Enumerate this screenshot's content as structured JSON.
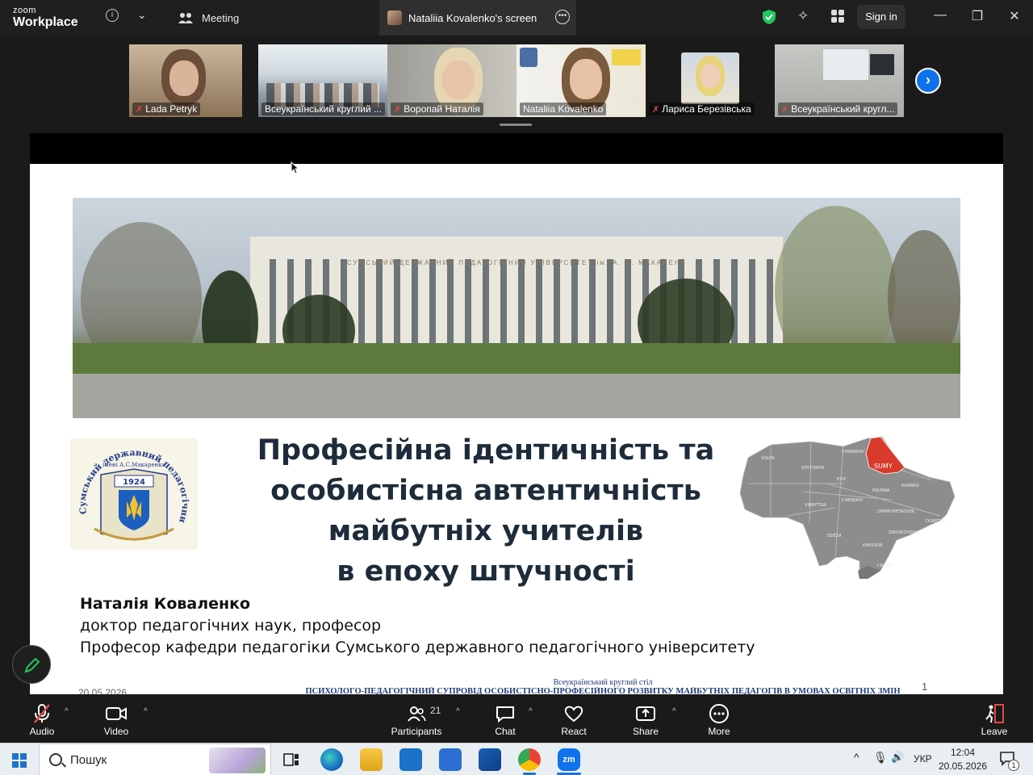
{
  "app": {
    "logo_top": "zoom",
    "logo_bottom": "Workplace",
    "meeting_tab": "Meeting",
    "screen_tab": "Nataliia Kovalenko's screen",
    "signin_label": "Sign in"
  },
  "participants_strip": [
    {
      "name": "Lada Petryk",
      "muted": true
    },
    {
      "name": "Всеукраїнський круглий ...",
      "muted": false
    },
    {
      "name": "Воропай Наталія",
      "muted": true
    },
    {
      "name": "Nataliia Kovalenko",
      "muted": false,
      "active": true
    },
    {
      "name": "Лариса Березівська",
      "muted": true
    },
    {
      "name": "Всеукраїнський кругл...",
      "muted": true
    }
  ],
  "slide": {
    "title_lines": [
      "Професійна ідентичність та",
      "особистісна автентичність",
      "майбутніх учителів",
      "в епоху штучності"
    ],
    "author_name": "Наталія Коваленко",
    "author_degree": "доктор педагогічних наук, професор",
    "author_position": "Професор кафедри педагогіки Сумського державного педагогічного університету",
    "footer_top": "Всеукраїнський круглий стіл",
    "footer_main": "ПСИХОЛОГО-ПЕДАГОГІЧНИЙ СУПРОВІД ОСОБИСТІСНО-ПРОФЕСІЙНОГО РОЗВИТКУ МАЙБУТНІХ ПЕДАГОГІВ В УМОВАХ ОСВІТНІХ ЗМІН",
    "footer_date": "20.05.2026",
    "page_number": "1",
    "seal_text_outer": "Сумський державний педагогічний університет",
    "seal_text_inner": "імені А.С.Макаренка",
    "seal_year": "1924",
    "building_sign": "СУМСЬКИЙ ДЕРЖАВНИЙ ПЕДАГОГІЧНИЙ УНІВЕРСИТЕТ ім. А. С. МАКАРЕНКА",
    "map_highlight": "SUMY",
    "map_labels": [
      "VOLYN",
      "ZHYTOMYR",
      "CHERNIHIV",
      "POLTAVA",
      "KHARKIV",
      "VINNYTSIA",
      "CHERKASY",
      "DNIPROPETROVSK",
      "DONETSK",
      "ODESA",
      "KHERSON",
      "ZAPORIZHZHIA",
      "CRIMEA",
      "KYIV"
    ]
  },
  "toolbar": {
    "audio": "Audio",
    "video": "Video",
    "participants": "Participants",
    "participants_count": "21",
    "chat": "Chat",
    "react": "React",
    "share": "Share",
    "more": "More",
    "leave": "Leave"
  },
  "taskbar": {
    "search_label": "Пошук",
    "language": "УКР",
    "time": "12:04",
    "date": "20.05.2026",
    "notification_count": "1"
  },
  "colors": {
    "accent": "#0e72ed",
    "active_border": "#22c55e",
    "muted": "#e24a4a",
    "title": "#1e2b3a",
    "map_highlight": "#d93a2b"
  }
}
